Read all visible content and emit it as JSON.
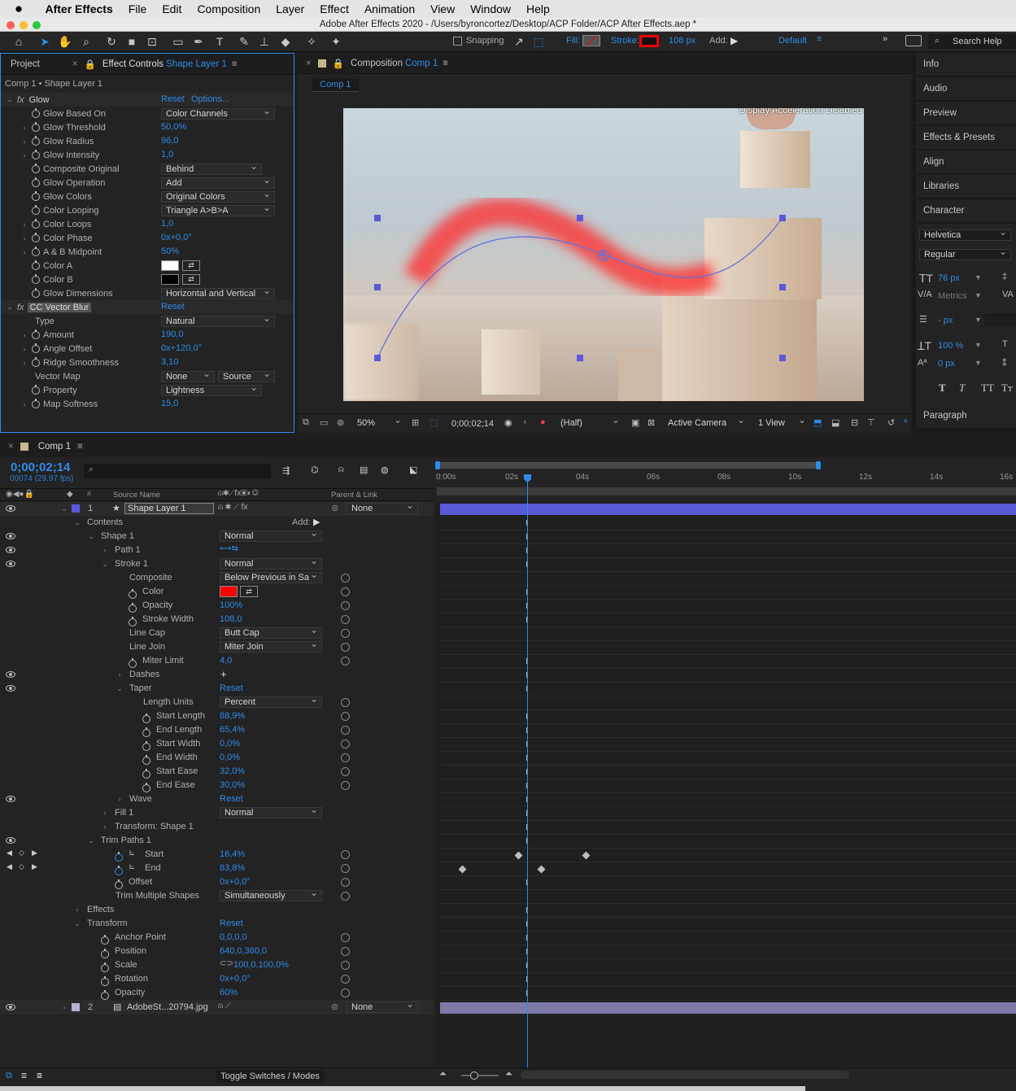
{
  "menubar": {
    "app": "After Effects",
    "items": [
      "File",
      "Edit",
      "Composition",
      "Layer",
      "Effect",
      "Animation",
      "View",
      "Window",
      "Help"
    ]
  },
  "window_title": "Adobe After Effects 2020 - /Users/byroncortez/Desktop/ACP Folder/ACP After Effects.aep *",
  "toolbar": {
    "snapping": "Snapping",
    "fill": "Fill:",
    "stroke": "Stroke:",
    "stroke_px": "108 px",
    "add": "Add:",
    "workspace": "Default",
    "search": "Search Help"
  },
  "left_panel": {
    "tab_project": "Project",
    "tab_effect_controls": "Effect Controls",
    "tab_effect_layer": "Shape Layer 1",
    "breadcrumb": "Comp 1 • Shape Layer 1",
    "glow": {
      "name": "Glow",
      "reset": "Reset",
      "options": "Options...",
      "props": [
        {
          "label": "Glow Based On",
          "dd": "Color Channels"
        },
        {
          "label": "Glow Threshold",
          "value": "50,0%"
        },
        {
          "label": "Glow Radius",
          "value": "96,0"
        },
        {
          "label": "Glow Intensity",
          "value": "1,0"
        },
        {
          "label": "Composite Original",
          "dd": "Behind"
        },
        {
          "label": "Glow Operation",
          "dd": "Add"
        },
        {
          "label": "Glow Colors",
          "dd": "Original Colors"
        },
        {
          "label": "Color Looping",
          "dd": "Triangle A>B>A"
        },
        {
          "label": "Color Loops",
          "value": "1,0"
        },
        {
          "label": "Color Phase",
          "value": "0x+0,0°"
        },
        {
          "label": "A & B Midpoint",
          "value": "50%"
        },
        {
          "label": "Color A"
        },
        {
          "label": "Color B"
        },
        {
          "label": "Glow Dimensions",
          "dd": "Horizontal and Vertical"
        }
      ]
    },
    "blur": {
      "name": "CC Vector Blur",
      "reset": "Reset",
      "props": [
        {
          "label": "Type",
          "dd": "Natural"
        },
        {
          "label": "Amount",
          "value": "190,0"
        },
        {
          "label": "Angle Offset",
          "value": "0x+120,0°"
        },
        {
          "label": "Ridge Smoothness",
          "value": "3,10"
        },
        {
          "label": "Vector Map",
          "dd": "None",
          "dd2": "Source"
        },
        {
          "label": "Property",
          "dd": "Lightness"
        },
        {
          "label": "Map Softness",
          "value": "15,0"
        }
      ]
    }
  },
  "comp_panel": {
    "tab_label": "Composition",
    "tab_name": "Comp 1",
    "subtab": "Comp 1",
    "overlay": "Display Acceleration Disabled",
    "zoom": "50%",
    "time": "0;00;02;14",
    "resolution": "(Half)",
    "camera": "Active Camera",
    "views": "1 View"
  },
  "right_panel": {
    "items": [
      "Info",
      "Audio",
      "Preview",
      "Effects & Presets",
      "Align",
      "Libraries",
      "Character"
    ],
    "font": "Helvetica",
    "style": "Regular",
    "size": "76 px",
    "metrics": "Metrics",
    "leading": "- px",
    "vscale": "100 %",
    "baseline": "0 px",
    "paragraph": "Paragraph"
  },
  "timeline": {
    "tab": "Comp 1",
    "timecode": "0;00;02;14",
    "frames": "00074 (29.97 fps)",
    "source_name": "Source Name",
    "parent_link": "Parent & Link",
    "ticks": [
      "0:00s",
      "02s",
      "04s",
      "06s",
      "08s",
      "10s",
      "12s",
      "14s",
      "16s"
    ],
    "layer1": {
      "num": "1",
      "name": "Shape Layer 1",
      "parent": "None"
    },
    "layer2": {
      "num": "2",
      "name": "AdobeSt...20794.jpg",
      "parent": "None"
    },
    "contents": "Contents",
    "add": "Add:",
    "shape1": "Shape 1",
    "shape1_mode": "Normal",
    "path1": "Path 1",
    "stroke1": "Stroke 1",
    "stroke1_mode": "Normal",
    "composite": "Composite",
    "composite_dd": "Below Previous in Sa",
    "color": "Color",
    "opacity_lab": "Opacity",
    "opacity_val": "100%",
    "stroke_width": "Stroke Width",
    "stroke_width_val": "108,0",
    "line_cap": "Line Cap",
    "line_cap_dd": "Butt Cap",
    "line_join": "Line Join",
    "line_join_dd": "Miter Join",
    "miter": "Miter Limit",
    "miter_val": "4,0",
    "dashes": "Dashes",
    "taper": "Taper",
    "reset": "Reset",
    "length_units": "Length Units",
    "length_units_dd": "Percent",
    "taper_props": [
      {
        "label": "Start Length",
        "value": "88,9%"
      },
      {
        "label": "End Length",
        "value": "65,4%"
      },
      {
        "label": "Start Width",
        "value": "0,0%"
      },
      {
        "label": "End Width",
        "value": "0,0%"
      },
      {
        "label": "Start Ease",
        "value": "32,0%"
      },
      {
        "label": "End Ease",
        "value": "30,0%"
      }
    ],
    "wave": "Wave",
    "fill1": "Fill 1",
    "fill1_mode": "Normal",
    "transform_shape": "Transform: Shape 1",
    "trim": "Trim Paths 1",
    "start": "Start",
    "start_val": "16,4%",
    "end": "End",
    "end_val": "83,8%",
    "offset": "Offset",
    "offset_val": "0x+0,0°",
    "trim_multi": "Trim Multiple Shapes",
    "trim_multi_dd": "Simultaneously",
    "effects": "Effects",
    "transform": "Transform",
    "transform_props": [
      {
        "label": "Anchor Point",
        "value": "0,0,0,0"
      },
      {
        "label": "Position",
        "value": "640,0,360,0"
      },
      {
        "label": "Scale",
        "value": "100,0,100,0%"
      },
      {
        "label": "Rotation",
        "value": "0x+0,0°"
      },
      {
        "label": "Opacity",
        "value": "60%"
      }
    ],
    "toggle": "Toggle Switches / Modes"
  },
  "colors": {
    "accent": "#2d8ceb",
    "stroke_red": "#ff0000",
    "selection": "#5a5ad8"
  }
}
